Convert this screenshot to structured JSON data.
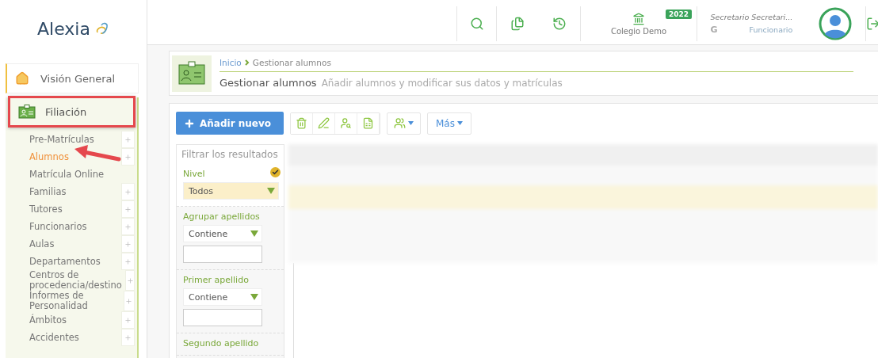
{
  "logo": {
    "text": "Alexia"
  },
  "header": {
    "school": "Colegio Demo",
    "year": "2022",
    "user_name": "Secretario Secretari...",
    "user_initial": "G",
    "user_role": "Funcionario"
  },
  "sidebar": {
    "overview": {
      "label": "Visión General",
      "selected": false
    },
    "section": {
      "label": "Filiación",
      "selected": true,
      "highlighted": true
    },
    "items": [
      {
        "label": "Pre-Matrículas",
        "selected": false,
        "has_add": true
      },
      {
        "label": "Alumnos",
        "selected": true,
        "has_add": true
      },
      {
        "label": "Matrícula Online",
        "selected": false,
        "has_add": false
      },
      {
        "label": "Familias",
        "selected": false,
        "has_add": true
      },
      {
        "label": "Tutores",
        "selected": false,
        "has_add": true
      },
      {
        "label": "Funcionarios",
        "selected": false,
        "has_add": true
      },
      {
        "label": "Aulas",
        "selected": false,
        "has_add": true
      },
      {
        "label": "Departamentos",
        "selected": false,
        "has_add": true
      },
      {
        "label": "Centros de procedencia/destino",
        "selected": false,
        "has_add": true
      },
      {
        "label": "Informes de Personalidad",
        "selected": false,
        "has_add": true
      },
      {
        "label": "Ámbitos",
        "selected": false,
        "has_add": true
      },
      {
        "label": "Accidentes",
        "selected": false,
        "has_add": true
      }
    ]
  },
  "breadcrumb": {
    "home": "Inicio",
    "current": "Gestionar alumnos",
    "title": "Gestionar alumnos",
    "subtitle": "Añadir alumnos y modificar sus datos y matrículas"
  },
  "toolbar": {
    "add_button": "Añadir nuevo",
    "more_button": "Más"
  },
  "filter": {
    "title": "Filtrar los resultados",
    "fields": [
      {
        "kind": "select",
        "label": "Nivel",
        "value": "Todos",
        "active": true
      },
      {
        "kind": "text",
        "label": "Agrupar apellidos",
        "operator": "Contiene",
        "active": false
      },
      {
        "kind": "text",
        "label": "Primer apellido",
        "operator": "Contiene",
        "active": false
      },
      {
        "kind": "heading",
        "label": "Segundo apellido",
        "active": false
      }
    ]
  }
}
